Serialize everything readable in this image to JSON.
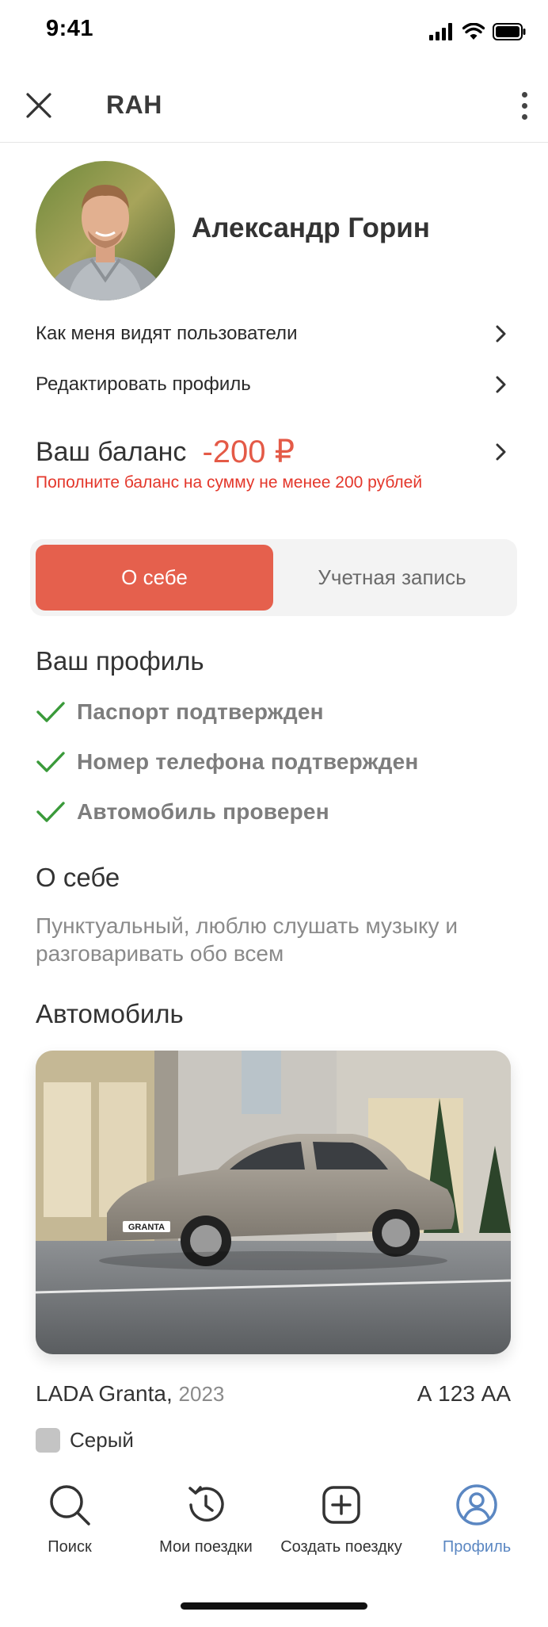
{
  "status_bar": {
    "time": "9:41"
  },
  "header": {
    "title": "RAH"
  },
  "profile": {
    "name": "Александр Горин",
    "menu": [
      {
        "label": "Как меня видят пользователи"
      },
      {
        "label": "Редактировать профиль"
      }
    ],
    "balance": {
      "label": "Ваш баланс",
      "value": "-200 ₽",
      "warning": "Пополните баланс на сумму не менее 200 рублей"
    }
  },
  "tabs": {
    "active": "О себе",
    "inactive": "Учетная запись"
  },
  "verification": {
    "title": "Ваш профиль",
    "items": [
      "Паспорт подтвержден",
      "Номер телефона подтвержден",
      "Автомобиль проверен"
    ]
  },
  "about": {
    "title": "О себе",
    "text": "Пунктуальный, люблю слушать музыку и разговаривать обо всем"
  },
  "car": {
    "title": "Автомобиль",
    "model": "LADA Granta,",
    "year": "2023",
    "plate": "А 123 АА",
    "color_name": "Серый",
    "color_hex": "#c4c4c4",
    "badge_text": "GRANTA"
  },
  "bottom_nav": [
    {
      "label": "Поиск",
      "icon": "search-icon"
    },
    {
      "label": "Мои поездки",
      "icon": "history-icon"
    },
    {
      "label": "Создать поездку",
      "icon": "plus-square-icon"
    },
    {
      "label": "Профиль",
      "icon": "profile-icon",
      "active": true
    }
  ],
  "colors": {
    "accent": "#e5604d",
    "balance_negative": "#e45a47",
    "warning": "#e4372b",
    "check": "#3a9a3a",
    "active_tab": "#5b87c2"
  }
}
